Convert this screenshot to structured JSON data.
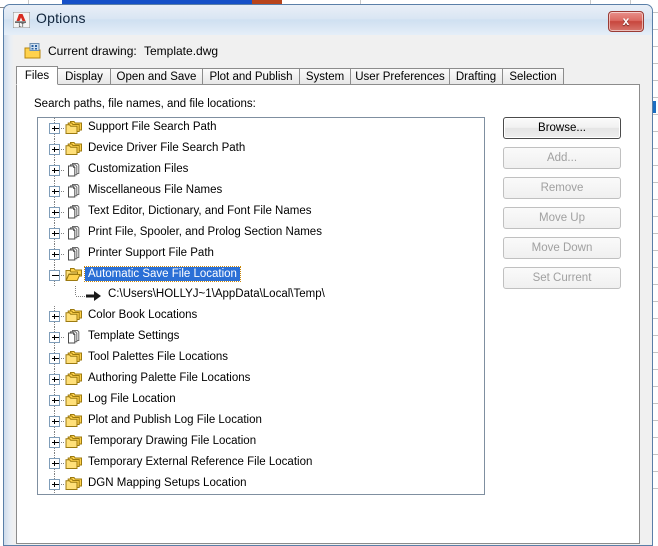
{
  "window": {
    "title": "Options",
    "app_icon": "autocad-lt-icon",
    "close_label": "x"
  },
  "current_drawing": {
    "icon": "drawing-icon",
    "label": "Current drawing:",
    "value": "Template.dwg"
  },
  "tabs": [
    {
      "label": "Files",
      "active": true
    },
    {
      "label": "Display",
      "active": false
    },
    {
      "label": "Open and Save",
      "active": false
    },
    {
      "label": "Plot and Publish",
      "active": false
    },
    {
      "label": "System",
      "active": false
    },
    {
      "label": "User Preferences",
      "active": false
    },
    {
      "label": "Drafting",
      "active": false
    },
    {
      "label": "Selection",
      "active": false
    }
  ],
  "panel": {
    "title": "Search paths, file names, and file locations:"
  },
  "tree": {
    "nodes": [
      {
        "label": "Support File Search Path",
        "icon": "folder-stack-icon",
        "expanded": false,
        "selected": false
      },
      {
        "label": "Device Driver File Search Path",
        "icon": "folder-stack-icon",
        "expanded": false,
        "selected": false
      },
      {
        "label": "Customization Files",
        "icon": "file-stack-icon",
        "expanded": false,
        "selected": false
      },
      {
        "label": "Miscellaneous File Names",
        "icon": "file-stack-icon",
        "expanded": false,
        "selected": false
      },
      {
        "label": "Text Editor, Dictionary, and Font File Names",
        "icon": "file-stack-icon",
        "expanded": false,
        "selected": false
      },
      {
        "label": "Print File, Spooler, and Prolog Section Names",
        "icon": "file-stack-icon",
        "expanded": false,
        "selected": false
      },
      {
        "label": "Printer Support File Path",
        "icon": "file-stack-icon",
        "expanded": false,
        "selected": false
      },
      {
        "label": "Automatic Save File Location",
        "icon": "folder-open-icon",
        "expanded": true,
        "selected": true,
        "children": [
          {
            "label": "C:\\Users\\HOLLYJ~1\\AppData\\Local\\Temp\\",
            "icon": "arrow-icon"
          }
        ]
      },
      {
        "label": "Color Book Locations",
        "icon": "folder-stack-icon",
        "expanded": false,
        "selected": false
      },
      {
        "label": "Template Settings",
        "icon": "file-stack-icon",
        "expanded": false,
        "selected": false
      },
      {
        "label": "Tool Palettes File Locations",
        "icon": "folder-stack-icon",
        "expanded": false,
        "selected": false
      },
      {
        "label": "Authoring Palette File Locations",
        "icon": "folder-stack-icon",
        "expanded": false,
        "selected": false
      },
      {
        "label": "Log File Location",
        "icon": "folder-stack-icon",
        "expanded": false,
        "selected": false
      },
      {
        "label": "Plot and Publish Log File Location",
        "icon": "folder-stack-icon",
        "expanded": false,
        "selected": false
      },
      {
        "label": "Temporary Drawing File Location",
        "icon": "folder-stack-icon",
        "expanded": false,
        "selected": false
      },
      {
        "label": "Temporary External Reference File Location",
        "icon": "folder-stack-icon",
        "expanded": false,
        "selected": false
      },
      {
        "label": "DGN Mapping Setups Location",
        "icon": "folder-stack-icon",
        "expanded": false,
        "selected": false
      }
    ]
  },
  "buttons": [
    {
      "label": "Browse...",
      "enabled": true,
      "default": true
    },
    {
      "label": "Add...",
      "enabled": false,
      "default": false
    },
    {
      "label": "Remove",
      "enabled": false,
      "default": false
    },
    {
      "label": "Move Up",
      "enabled": false,
      "default": false
    },
    {
      "label": "Move Down",
      "enabled": false,
      "default": false
    },
    {
      "label": "Set Current",
      "enabled": false,
      "default": false
    }
  ],
  "colors": {
    "selection_blue": "#2a6fd6",
    "folder_yellow": "#ffd24d",
    "close_red": "#c7463d",
    "title_glass": "#cfe0f1"
  }
}
